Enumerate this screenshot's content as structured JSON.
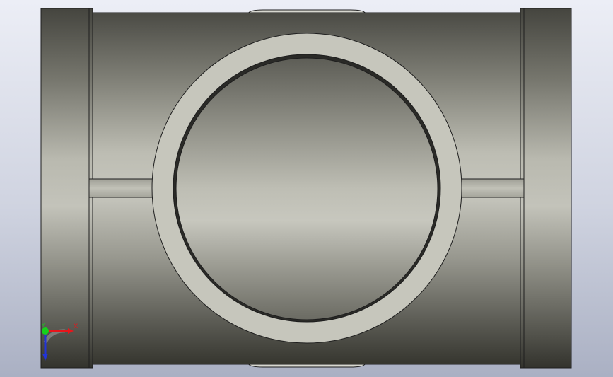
{
  "viewport": {
    "name": "graphics-area",
    "background_top": "#e9ebf4",
    "background_bottom": "#aeb4c6"
  },
  "model": {
    "name": "pipe-tee-fitting",
    "view": "top",
    "body_light": "#c3c3b9",
    "body_dark": "#3d3d38",
    "edge_color": "#1e1e1e"
  },
  "triad": {
    "x_label": "X",
    "y_label": "Y",
    "x_color": "#e8151b",
    "y_color": "#16d11b",
    "z_color": "#2234d8"
  }
}
